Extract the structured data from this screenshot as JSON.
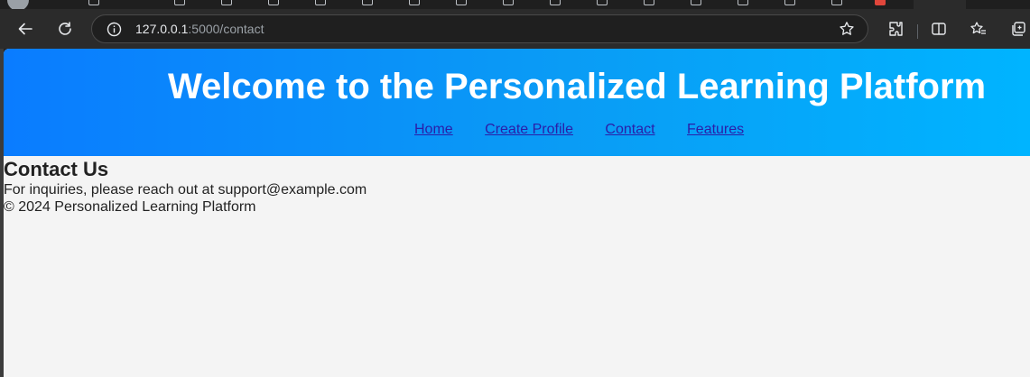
{
  "browser": {
    "url_host": "127.0.0.1",
    "url_path": ":5000/contact",
    "icons": {
      "back": "back-arrow-icon",
      "reload": "reload-icon",
      "info": "info-icon",
      "favorite": "star-icon",
      "extensions": "extensions-icon",
      "split_screen": "split-screen-icon",
      "favorites_bar": "favorites-icon",
      "collections": "collections-icon"
    }
  },
  "page": {
    "header_title": "Welcome to the Personalized Learning Platform",
    "nav": [
      {
        "label": "Home"
      },
      {
        "label": "Create Profile"
      },
      {
        "label": "Contact"
      },
      {
        "label": "Features"
      }
    ],
    "section_title": "Contact Us",
    "inquiry_text": "For inquiries, please reach out at support@example.com",
    "footer_text": "© 2024 Personalized Learning Platform"
  },
  "colors": {
    "header_gradient_start": "#0a7cff",
    "header_gradient_end": "#00b4ff",
    "header_text": "#ffffff",
    "link": "#2a1ea8",
    "page_background": "#f4f4f4"
  }
}
